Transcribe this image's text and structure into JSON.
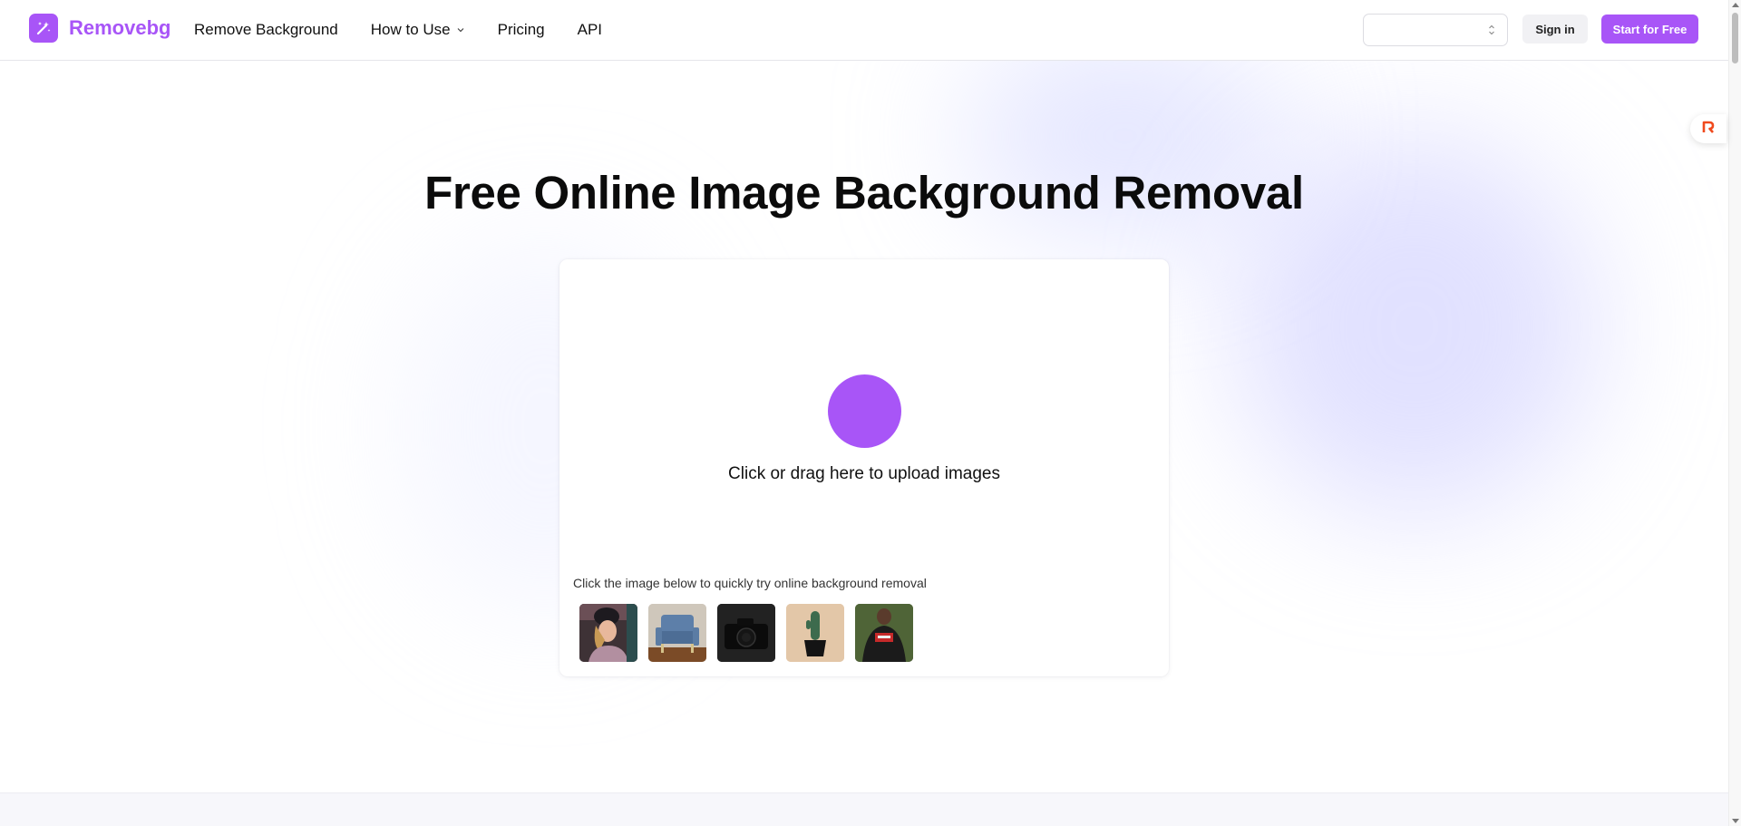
{
  "brand": {
    "name": "Removebg",
    "color": "#a855f7",
    "icon": "magic-wand-icon"
  },
  "nav": {
    "items": [
      {
        "label": "Remove Background"
      },
      {
        "label": "How to Use",
        "has_dropdown": true
      },
      {
        "label": "Pricing"
      },
      {
        "label": "API"
      }
    ]
  },
  "header": {
    "language_select": {
      "value": "",
      "icon": "chevron-up-down-icon"
    },
    "signin_label": "Sign in",
    "start_label": "Start for Free"
  },
  "hero": {
    "title": "Free Online Image Background Removal"
  },
  "upload": {
    "prompt": "Click or drag here to upload images",
    "sample_caption": "Click the image below to quickly try online background removal",
    "samples": [
      {
        "subject": "woman-in-beanie"
      },
      {
        "subject": "blue-armchair"
      },
      {
        "subject": "camera"
      },
      {
        "subject": "cactus-pot"
      },
      {
        "subject": "man-in-jersey"
      }
    ]
  },
  "floating_widget": {
    "icon": "r-logo-icon",
    "color": "#f04a1e"
  }
}
